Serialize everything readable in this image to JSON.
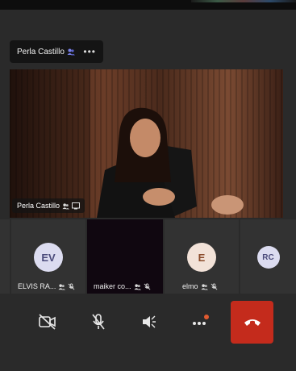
{
  "spotlight": {
    "name": "Perla Castillo",
    "more_label": "•••"
  },
  "main_video": {
    "label": "Perla Castillo"
  },
  "participants": [
    {
      "initials": "EV",
      "name": "ELVIS RA...",
      "avatar_bg": "#dcdcf0",
      "avatar_fg": "#4a4a7a"
    },
    {
      "initials": "",
      "name": "maiker co...",
      "avatar_bg": "",
      "avatar_fg": ""
    },
    {
      "initials": "E",
      "name": "elmo",
      "avatar_bg": "#f2e2d8",
      "avatar_fg": "#8a4a2a"
    },
    {
      "initials": "RC",
      "name": "",
      "avatar_bg": "#dcdcf0",
      "avatar_fg": "#4a4a7a"
    }
  ],
  "controls": {
    "camera": "camera-off-icon",
    "mic": "mic-off-icon",
    "speaker": "speaker-icon",
    "more": "more-icon",
    "hangup": "hang-up-icon"
  },
  "colors": {
    "hangup": "#c42b1c",
    "notification_dot": "#e05a30",
    "background": "#2a2a2a"
  }
}
